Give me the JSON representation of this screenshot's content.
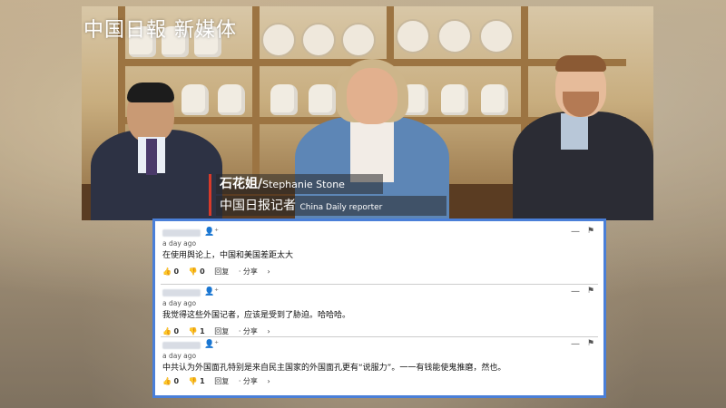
{
  "video": {
    "watermark": "中国日報 新媒体",
    "caption_name_zh": "石花姐/",
    "caption_name_en": "Stephanie Stone",
    "caption_title_zh": "中国日报记者",
    "caption_title_en": "China Daily reporter"
  },
  "comments": [
    {
      "time": "a day ago",
      "text": "在使用舆论上，中国和美国差距太大",
      "likes": "0",
      "dislikes": "0",
      "reply_label": "回复",
      "share_label": "分享"
    },
    {
      "time": "a day ago",
      "text": "我觉得这些外国记者，应该是受到了胁迫。哈哈哈。",
      "likes": "0",
      "dislikes": "1",
      "reply_label": "回复",
      "share_label": "分享"
    },
    {
      "time": "a day ago",
      "text": "中共认为外国面孔特别是来自民主国家的外国面孔更有“说服力”。一一有钱能使鬼推磨，然也。",
      "likes": "0",
      "dislikes": "1",
      "reply_label": "回复",
      "share_label": "分享"
    }
  ],
  "icons": {
    "user": "user-icon",
    "like": "thumbs-up-icon",
    "dislike": "thumbs-down-icon",
    "more": "more-icon",
    "flag": "flag-icon"
  },
  "colors": {
    "overlay_border": "#4a7fd8",
    "caption_accent": "#d83a2a"
  }
}
